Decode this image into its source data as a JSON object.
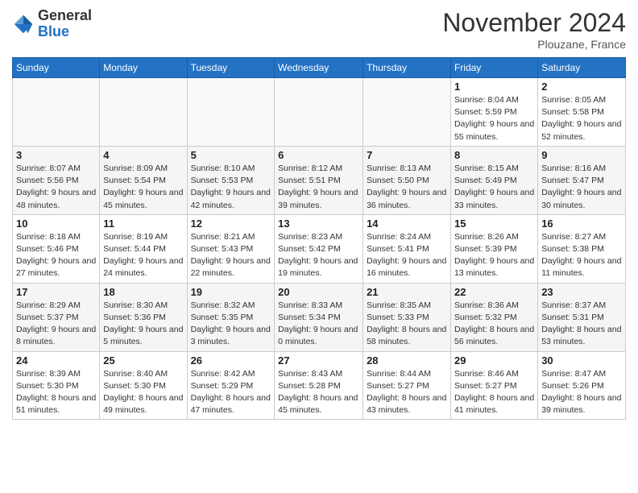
{
  "logo": {
    "line1": "General",
    "line2": "Blue"
  },
  "title": "November 2024",
  "subtitle": "Plouzane, France",
  "weekdays": [
    "Sunday",
    "Monday",
    "Tuesday",
    "Wednesday",
    "Thursday",
    "Friday",
    "Saturday"
  ],
  "weeks": [
    [
      {
        "day": "",
        "info": ""
      },
      {
        "day": "",
        "info": ""
      },
      {
        "day": "",
        "info": ""
      },
      {
        "day": "",
        "info": ""
      },
      {
        "day": "",
        "info": ""
      },
      {
        "day": "1",
        "info": "Sunrise: 8:04 AM\nSunset: 5:59 PM\nDaylight: 9 hours and 55 minutes."
      },
      {
        "day": "2",
        "info": "Sunrise: 8:05 AM\nSunset: 5:58 PM\nDaylight: 9 hours and 52 minutes."
      }
    ],
    [
      {
        "day": "3",
        "info": "Sunrise: 8:07 AM\nSunset: 5:56 PM\nDaylight: 9 hours and 48 minutes."
      },
      {
        "day": "4",
        "info": "Sunrise: 8:09 AM\nSunset: 5:54 PM\nDaylight: 9 hours and 45 minutes."
      },
      {
        "day": "5",
        "info": "Sunrise: 8:10 AM\nSunset: 5:53 PM\nDaylight: 9 hours and 42 minutes."
      },
      {
        "day": "6",
        "info": "Sunrise: 8:12 AM\nSunset: 5:51 PM\nDaylight: 9 hours and 39 minutes."
      },
      {
        "day": "7",
        "info": "Sunrise: 8:13 AM\nSunset: 5:50 PM\nDaylight: 9 hours and 36 minutes."
      },
      {
        "day": "8",
        "info": "Sunrise: 8:15 AM\nSunset: 5:49 PM\nDaylight: 9 hours and 33 minutes."
      },
      {
        "day": "9",
        "info": "Sunrise: 8:16 AM\nSunset: 5:47 PM\nDaylight: 9 hours and 30 minutes."
      }
    ],
    [
      {
        "day": "10",
        "info": "Sunrise: 8:18 AM\nSunset: 5:46 PM\nDaylight: 9 hours and 27 minutes."
      },
      {
        "day": "11",
        "info": "Sunrise: 8:19 AM\nSunset: 5:44 PM\nDaylight: 9 hours and 24 minutes."
      },
      {
        "day": "12",
        "info": "Sunrise: 8:21 AM\nSunset: 5:43 PM\nDaylight: 9 hours and 22 minutes."
      },
      {
        "day": "13",
        "info": "Sunrise: 8:23 AM\nSunset: 5:42 PM\nDaylight: 9 hours and 19 minutes."
      },
      {
        "day": "14",
        "info": "Sunrise: 8:24 AM\nSunset: 5:41 PM\nDaylight: 9 hours and 16 minutes."
      },
      {
        "day": "15",
        "info": "Sunrise: 8:26 AM\nSunset: 5:39 PM\nDaylight: 9 hours and 13 minutes."
      },
      {
        "day": "16",
        "info": "Sunrise: 8:27 AM\nSunset: 5:38 PM\nDaylight: 9 hours and 11 minutes."
      }
    ],
    [
      {
        "day": "17",
        "info": "Sunrise: 8:29 AM\nSunset: 5:37 PM\nDaylight: 9 hours and 8 minutes."
      },
      {
        "day": "18",
        "info": "Sunrise: 8:30 AM\nSunset: 5:36 PM\nDaylight: 9 hours and 5 minutes."
      },
      {
        "day": "19",
        "info": "Sunrise: 8:32 AM\nSunset: 5:35 PM\nDaylight: 9 hours and 3 minutes."
      },
      {
        "day": "20",
        "info": "Sunrise: 8:33 AM\nSunset: 5:34 PM\nDaylight: 9 hours and 0 minutes."
      },
      {
        "day": "21",
        "info": "Sunrise: 8:35 AM\nSunset: 5:33 PM\nDaylight: 8 hours and 58 minutes."
      },
      {
        "day": "22",
        "info": "Sunrise: 8:36 AM\nSunset: 5:32 PM\nDaylight: 8 hours and 56 minutes."
      },
      {
        "day": "23",
        "info": "Sunrise: 8:37 AM\nSunset: 5:31 PM\nDaylight: 8 hours and 53 minutes."
      }
    ],
    [
      {
        "day": "24",
        "info": "Sunrise: 8:39 AM\nSunset: 5:30 PM\nDaylight: 8 hours and 51 minutes."
      },
      {
        "day": "25",
        "info": "Sunrise: 8:40 AM\nSunset: 5:30 PM\nDaylight: 8 hours and 49 minutes."
      },
      {
        "day": "26",
        "info": "Sunrise: 8:42 AM\nSunset: 5:29 PM\nDaylight: 8 hours and 47 minutes."
      },
      {
        "day": "27",
        "info": "Sunrise: 8:43 AM\nSunset: 5:28 PM\nDaylight: 8 hours and 45 minutes."
      },
      {
        "day": "28",
        "info": "Sunrise: 8:44 AM\nSunset: 5:27 PM\nDaylight: 8 hours and 43 minutes."
      },
      {
        "day": "29",
        "info": "Sunrise: 8:46 AM\nSunset: 5:27 PM\nDaylight: 8 hours and 41 minutes."
      },
      {
        "day": "30",
        "info": "Sunrise: 8:47 AM\nSunset: 5:26 PM\nDaylight: 8 hours and 39 minutes."
      }
    ]
  ]
}
